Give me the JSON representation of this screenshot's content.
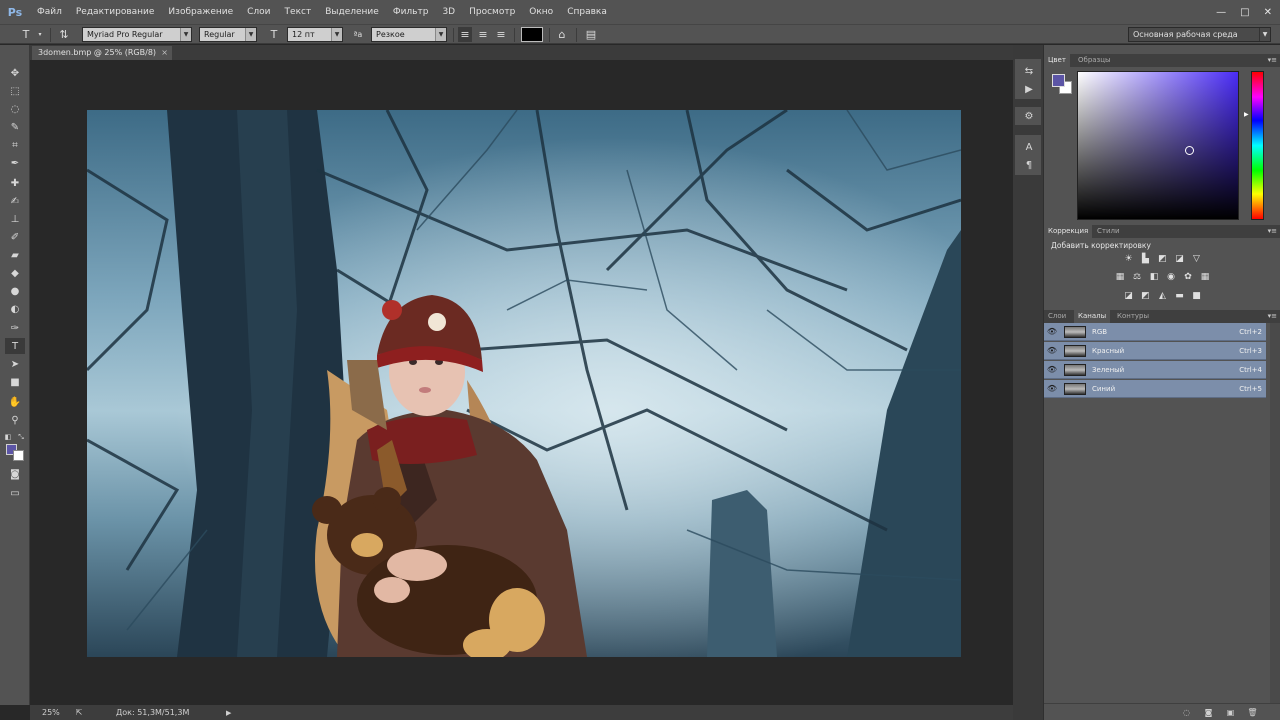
{
  "app": {
    "logo": "Ps",
    "menu": [
      "Файл",
      "Редактирование",
      "Изображение",
      "Слои",
      "Текст",
      "Выделение",
      "Фильтр",
      "3D",
      "Просмотр",
      "Окно",
      "Справка"
    ],
    "window_controls": [
      "—",
      "□",
      "✕"
    ]
  },
  "options": {
    "tool_icon": "T",
    "font_family": "Myriad Pro Regular",
    "font_style": "Regular",
    "size_icon": "T",
    "font_size": "12 пт",
    "aa_icon": "ªa",
    "antialias": "Резкое",
    "text_color": "#000000",
    "workspace": "Основная рабочая среда"
  },
  "document": {
    "tab_title": "3domen.bmp @ 25% (RGB/8)",
    "close": "×"
  },
  "status": {
    "zoom": "25%",
    "doc_size": "Док: 51,3M/51,3M",
    "arrow": "▶"
  },
  "colors": {
    "foreground": "#5c55a6",
    "background": "#ffffff"
  },
  "panels": {
    "color": {
      "tabs": [
        "Цвет",
        "Образцы"
      ]
    },
    "adjustments": {
      "tabs": [
        "Коррекция",
        "Стили"
      ],
      "title": "Добавить корректировку"
    },
    "layers": {
      "tabs": [
        "Слои",
        "Каналы",
        "Контуры"
      ],
      "channels": [
        {
          "name": "RGB",
          "shortcut": "Ctrl+2"
        },
        {
          "name": "Красный",
          "shortcut": "Ctrl+3"
        },
        {
          "name": "Зеленый",
          "shortcut": "Ctrl+4"
        },
        {
          "name": "Синий",
          "shortcut": "Ctrl+5"
        }
      ]
    }
  },
  "photo": {
    "description": "Photograph of a girl in a knitted hat hugging a teddy bear under bare winter branches"
  }
}
